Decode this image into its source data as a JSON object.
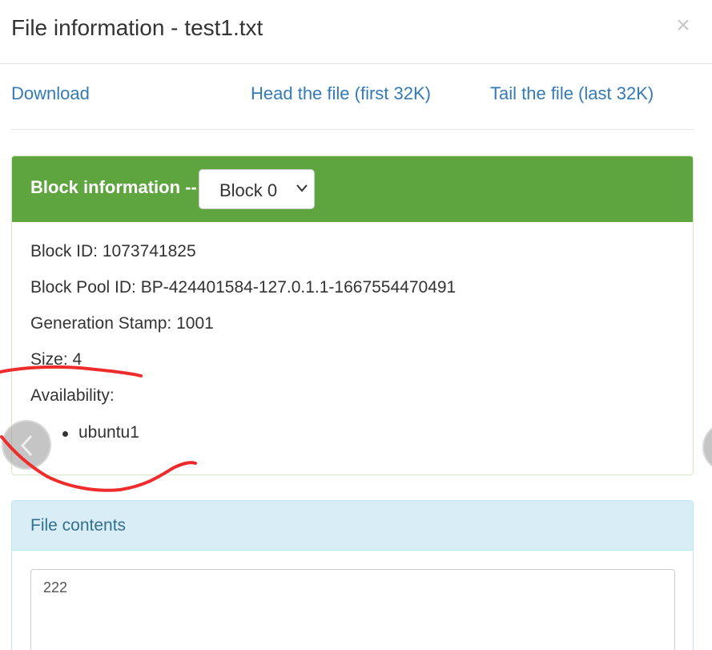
{
  "modal": {
    "title": "File information - test1.txt",
    "close_glyph": "×"
  },
  "links": {
    "download": "Download",
    "head": "Head the file (first 32K)",
    "tail": "Tail the file (last 32K)"
  },
  "block_panel": {
    "heading": "Block information --",
    "selected_block": "Block 0",
    "block_id": "Block ID: 1073741825",
    "block_pool_id": "Block Pool ID: BP-424401584-127.0.1.1-1667554470491",
    "generation_stamp": "Generation Stamp: 1001",
    "size": "Size: 4",
    "availability_label": "Availability:",
    "availability": [
      "ubuntu1"
    ]
  },
  "contents_panel": {
    "heading": "File contents",
    "text": "222"
  },
  "colors": {
    "success_heading": "#5ea43f",
    "info_heading": "#d9edf7",
    "link": "#337ab7",
    "annotation": "#ee2c2c"
  },
  "icons": {
    "close": "close-icon",
    "select_arrow": "chevron-down-icon",
    "prev": "chevron-left-icon",
    "next": "chevron-right-icon"
  }
}
